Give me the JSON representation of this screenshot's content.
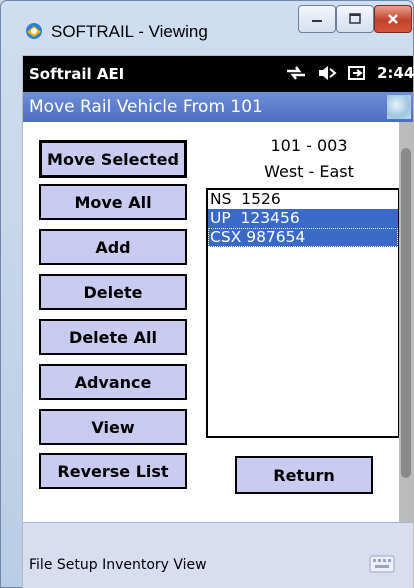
{
  "window": {
    "title": "SOFTRAIL - Viewing"
  },
  "status_bar": {
    "app_name": "Softrail AEI",
    "time": "2:44",
    "icons": [
      "connectivity-icon",
      "volume-icon",
      "battery-icon"
    ]
  },
  "header": {
    "title": "Move Rail Vehicle From 101"
  },
  "location": {
    "track": "101 - 003",
    "direction": "West - East"
  },
  "buttons": {
    "move_selected": "Move Selected",
    "move_all": "Move All",
    "add": "Add",
    "delete": "Delete",
    "delete_all": "Delete All",
    "advance": "Advance",
    "view": "View",
    "reverse_list": "Reverse List",
    "return": "Return"
  },
  "vehicles": [
    {
      "label": "NS  1526",
      "selected": false
    },
    {
      "label": "UP  123456",
      "selected": true
    },
    {
      "label": "CSX 987654",
      "selected": true
    }
  ],
  "menu": {
    "text": "File Setup Inventory View"
  },
  "colors": {
    "header_blue": "#4d6dc2",
    "button_fill": "#c9cbf0",
    "selection_blue": "#3a69c8",
    "close_red": "#c1412a"
  }
}
